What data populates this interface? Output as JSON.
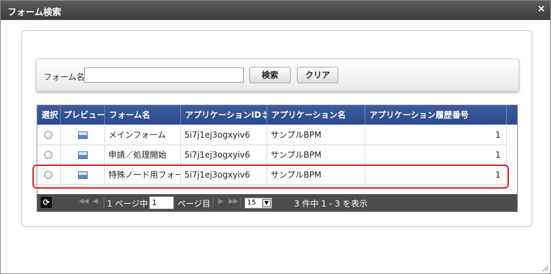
{
  "dialog": {
    "title": "フォーム検索",
    "close_glyph": "×"
  },
  "search": {
    "label": "フォーム名",
    "value": "",
    "placeholder": "",
    "search_button": "検索",
    "clear_button": "クリア"
  },
  "grid": {
    "columns": [
      "選択",
      "プレビュー",
      "フォーム名",
      "アプリケーションID",
      "アプリケーション名",
      "アプリケーション履歴番号"
    ],
    "rows": [
      {
        "name": "メインフォーム",
        "app_id": "5i7j1ej3ogxyiv6",
        "app_name": "サンプルBPM",
        "history": "1"
      },
      {
        "name": "申請／処理開始",
        "app_id": "5i7j1ej3ogxyiv6",
        "app_name": "サンプルBPM",
        "history": "1"
      },
      {
        "name": "特殊ノード用フォーム",
        "app_id": "5i7j1ej3ogxyiv6",
        "app_name": "サンプルBPM",
        "history": "1"
      }
    ]
  },
  "pager": {
    "page_prefix": "1 ページ中",
    "page_value": "1",
    "page_suffix": "ページ目",
    "page_size": "15",
    "summary": "3 件中 1 - 3 を表示"
  },
  "colors": {
    "titlebar": "#4a4a4a",
    "grid_header": "#34528f",
    "pager": "#4c4c4c",
    "highlight": "#d41d1d"
  }
}
